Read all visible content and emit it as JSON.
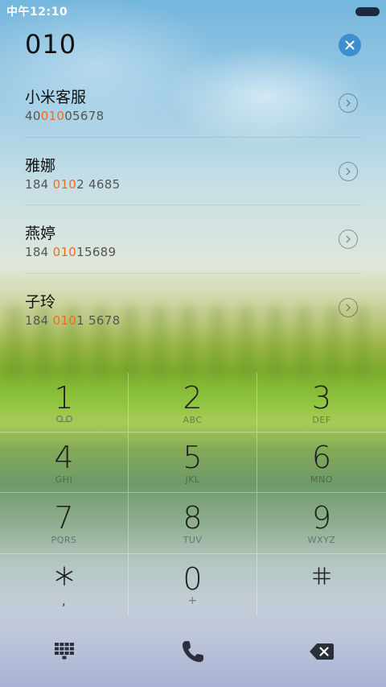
{
  "status": {
    "time": "中午12:10"
  },
  "dial": {
    "number": "010"
  },
  "results": [
    {
      "name": "小米客服",
      "num_pre": "40",
      "num_hl": "010",
      "num_post": "05678"
    },
    {
      "name": "雅娜",
      "num_pre": "184 ",
      "num_hl": "010",
      "num_post": "2 4685"
    },
    {
      "name": "燕婷",
      "num_pre": "184 ",
      "num_hl": "010",
      "num_post": "15689"
    },
    {
      "name": "子玲",
      "num_pre": "184 ",
      "num_hl": "010",
      "num_post": "1 5678"
    }
  ],
  "keypad": {
    "k1": {
      "digit": "1",
      "letters": ""
    },
    "k2": {
      "digit": "2",
      "letters": "ABC"
    },
    "k3": {
      "digit": "3",
      "letters": "DEF"
    },
    "k4": {
      "digit": "4",
      "letters": "GHI"
    },
    "k5": {
      "digit": "5",
      "letters": "JKL"
    },
    "k6": {
      "digit": "6",
      "letters": "MNO"
    },
    "k7": {
      "digit": "7",
      "letters": "PQRS"
    },
    "k8": {
      "digit": "8",
      "letters": "TUV"
    },
    "k9": {
      "digit": "9",
      "letters": "WXYZ"
    },
    "kstar": {
      "sub": ","
    },
    "k0": {
      "digit": "0",
      "letters": "+"
    },
    "khash": {}
  },
  "icons": {
    "clear": "close-icon",
    "chevron": "chevron-right-icon",
    "voicemail": "voicemail-icon",
    "asterisk": "asterisk-icon",
    "hash": "hash-icon",
    "dialpad": "dialpad-icon",
    "call": "phone-icon",
    "backspace": "backspace-icon"
  },
  "colors": {
    "highlight": "#f06a1e",
    "clear_button": "#3d8fd0"
  }
}
